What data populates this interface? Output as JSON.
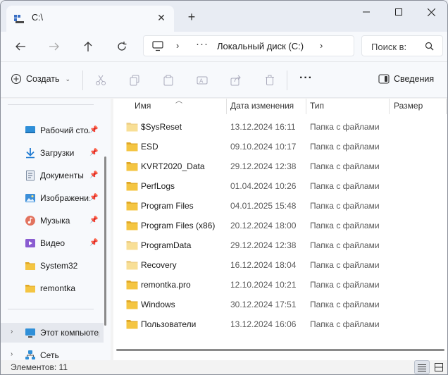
{
  "tab": {
    "title": "C:\\"
  },
  "address": {
    "location": "Локальный диск (C:)",
    "more": "···"
  },
  "search": {
    "placeholder": "Поиск в:"
  },
  "toolbar": {
    "new_label": "Создать",
    "details_label": "Сведения",
    "more_label": "···"
  },
  "sidebar": {
    "items": [
      {
        "label": "Рабочий стол",
        "icon": "desktop-icon",
        "pinned": true
      },
      {
        "label": "Загрузки",
        "icon": "downloads-icon",
        "pinned": true
      },
      {
        "label": "Документы",
        "icon": "documents-icon",
        "pinned": true
      },
      {
        "label": "Изображения",
        "icon": "pictures-icon",
        "pinned": true
      },
      {
        "label": "Музыка",
        "icon": "music-icon",
        "pinned": true
      },
      {
        "label": "Видео",
        "icon": "videos-icon",
        "pinned": true
      },
      {
        "label": "System32",
        "icon": "folder-icon",
        "pinned": false
      },
      {
        "label": "remontka",
        "icon": "folder-icon",
        "pinned": false
      }
    ],
    "this_pc": "Этот компьютер",
    "network": "Сеть"
  },
  "columns": {
    "name": "Имя",
    "date": "Дата изменения",
    "type": "Тип",
    "size": "Размер"
  },
  "files": [
    {
      "name": "$SysReset",
      "date": "13.12.2024 16:11",
      "type": "Папка с файлами",
      "hidden": true
    },
    {
      "name": "ESD",
      "date": "09.10.2024 10:17",
      "type": "Папка с файлами",
      "hidden": false
    },
    {
      "name": "KVRT2020_Data",
      "date": "29.12.2024 12:38",
      "type": "Папка с файлами",
      "hidden": false
    },
    {
      "name": "PerfLogs",
      "date": "01.04.2024 10:26",
      "type": "Папка с файлами",
      "hidden": false
    },
    {
      "name": "Program Files",
      "date": "04.01.2025 15:48",
      "type": "Папка с файлами",
      "hidden": false
    },
    {
      "name": "Program Files (x86)",
      "date": "20.12.2024 18:00",
      "type": "Папка с файлами",
      "hidden": false
    },
    {
      "name": "ProgramData",
      "date": "29.12.2024 12:38",
      "type": "Папка с файлами",
      "hidden": true
    },
    {
      "name": "Recovery",
      "date": "16.12.2024 18:04",
      "type": "Папка с файлами",
      "hidden": true
    },
    {
      "name": "remontka.pro",
      "date": "12.10.2024 10:21",
      "type": "Папка с файлами",
      "hidden": false
    },
    {
      "name": "Windows",
      "date": "30.12.2024 17:51",
      "type": "Папка с файлами",
      "hidden": false
    },
    {
      "name": "Пользователи",
      "date": "13.12.2024 16:06",
      "type": "Папка с файлами",
      "hidden": false
    }
  ],
  "status": {
    "items": "Элементов: 11"
  },
  "colors": {
    "folder": "#f4c542",
    "folder_dark": "#e0a826",
    "accent": "#0067c0"
  }
}
